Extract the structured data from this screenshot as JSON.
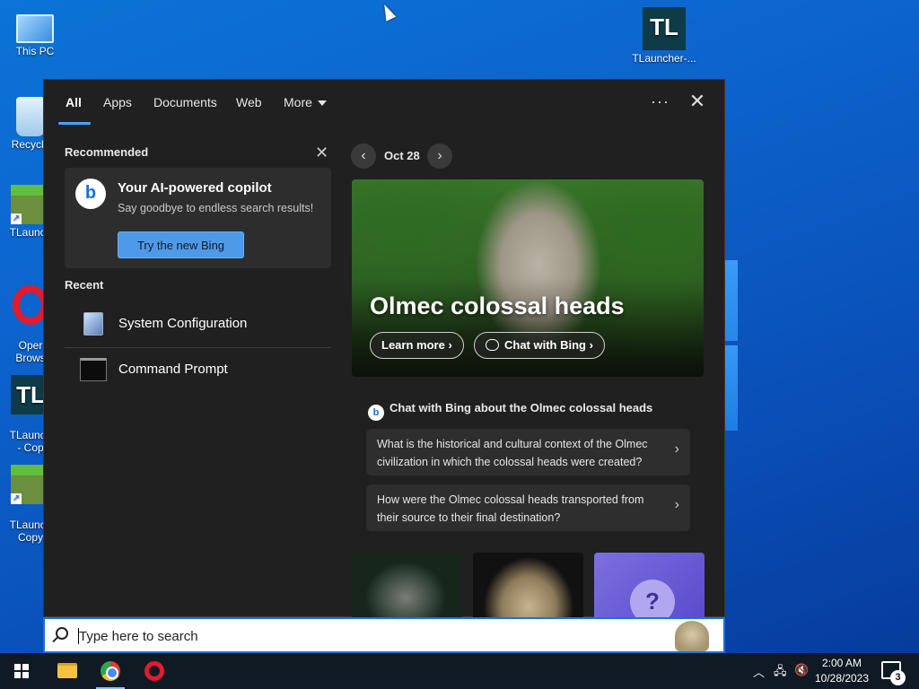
{
  "desktop": {
    "icons": [
      {
        "label": "This PC"
      },
      {
        "label": "Recycle"
      },
      {
        "label": "TLaunch"
      },
      {
        "label": "Oper\nBrows"
      },
      {
        "label": "TLaunch\n- Cop"
      },
      {
        "label": "TLaunch\nCopy"
      },
      {
        "label": "TLauncher-..."
      }
    ]
  },
  "search_panel": {
    "tabs": [
      {
        "label": "All"
      },
      {
        "label": "Apps"
      },
      {
        "label": "Documents"
      },
      {
        "label": "Web"
      },
      {
        "label": "More"
      }
    ],
    "more_icon": "ellipsis-icon",
    "recommended": {
      "title": "Recommended",
      "card_title": "Your AI-powered copilot",
      "card_subtitle": "Say goodbye to endless search results!",
      "button": "Try the new Bing"
    },
    "recent": {
      "title": "Recent",
      "items": [
        {
          "label": "System Configuration",
          "icon": "system-configuration-icon"
        },
        {
          "label": "Command Prompt",
          "icon": "command-prompt-icon"
        }
      ]
    },
    "highlight": {
      "date": "Oct 28",
      "hero_title": "Olmec colossal heads",
      "learn_more": "Learn more",
      "chat_with_bing": "Chat with Bing",
      "chat_heading": "Chat with Bing about the Olmec colossal heads",
      "questions": [
        {
          "text": "What is the historical and cultural context of the Olmec civilization in which the colossal heads were created?"
        },
        {
          "text": "How were the Olmec colossal heads transported from their source to their final destination?"
        }
      ]
    }
  },
  "searchbar": {
    "placeholder": "Type here to search"
  },
  "taskbar": {
    "apps": [
      "file-explorer-icon",
      "chrome-icon",
      "opera-icon"
    ],
    "clock_time": "2:00 AM",
    "clock_date": "10/28/2023",
    "notification_count": "3"
  },
  "colors": {
    "accent": "#1a73d6",
    "panel_bg": "#202020",
    "button_blue": "#4f9ae8"
  }
}
